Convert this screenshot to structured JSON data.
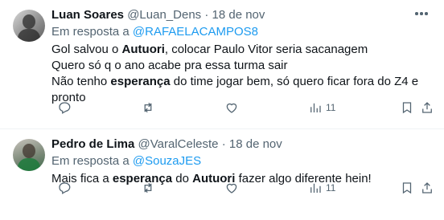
{
  "tweets": [
    {
      "name": "Luan Soares",
      "handle": "@Luan_Dens",
      "separator": "·",
      "date": "18 de nov",
      "replying_prefix": "Em resposta a ",
      "replying_to": "@RAFAELACAMPOS8",
      "lines": [
        {
          "a": "Gol salvou o ",
          "b": "Autuori",
          "c": ", colocar Paulo Vitor seria sacanagem"
        },
        {
          "a": "Quero só q o ano acabe pra essa turma sair",
          "b": "",
          "c": ""
        },
        {
          "a": "Não tenho ",
          "b": "esperança",
          "c": " do time jogar bem, só quero ficar fora do Z4 e"
        },
        {
          "a": "pronto",
          "b": "",
          "c": ""
        }
      ],
      "views": "11"
    },
    {
      "name": "Pedro de Lima",
      "handle": "@VaralCeleste",
      "separator": "·",
      "date": "18 de nov",
      "replying_prefix": "Em resposta a ",
      "replying_to": "@SouzaJES",
      "line": {
        "a": "Mais fica a ",
        "b": "esperança",
        "c": " do ",
        "d": "Autuori",
        "e": " fazer algo diferente hein!"
      },
      "views": "11"
    }
  ],
  "icons": [
    "more-icon",
    "reply-icon",
    "retweet-icon",
    "like-icon",
    "views-icon",
    "bookmark-icon",
    "share-icon"
  ],
  "colors": {
    "text": "#0f1419",
    "secondary": "#536471",
    "link": "#1d9bf0",
    "divider": "#eff3f4"
  }
}
